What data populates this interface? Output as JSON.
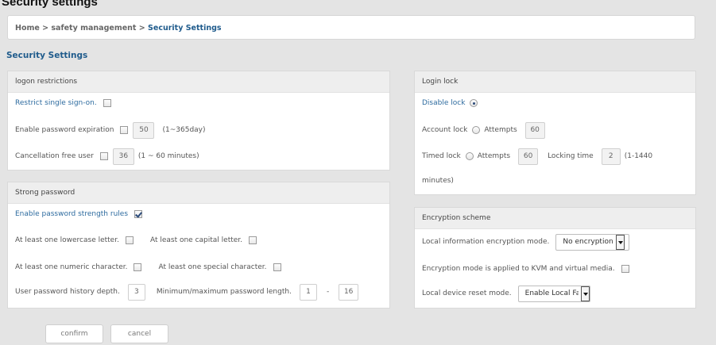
{
  "page": {
    "heading": "Security settings"
  },
  "breadcrumb": {
    "home": "Home",
    "sep1": " > ",
    "parent": "safety management",
    "sep2": " > ",
    "current": "Security Settings"
  },
  "section_title": "Security Settings",
  "logon_restrictions": {
    "header": "logon restrictions",
    "single_signon_label": "Restrict single sign-on.",
    "single_signon_checked": false,
    "pwd_expiration_label": "Enable password expiration",
    "pwd_expiration_checked": false,
    "pwd_expiration_value": "50",
    "pwd_expiration_hint": "(1~365day)",
    "cancellation_label": "Cancellation free user",
    "cancellation_checked": false,
    "cancellation_value": "36",
    "cancellation_hint": "(1 ~ 60 minutes)"
  },
  "strong_password": {
    "header": "Strong password",
    "enable_rules_label": "Enable password strength rules",
    "enable_rules_checked": true,
    "lowercase_label": "At least one lowercase letter.",
    "capital_label": "At least one capital letter.",
    "numeric_label": "At least one numeric character.",
    "special_label": "At least one special character.",
    "history_label": "User password history depth.",
    "history_value": "3",
    "length_label": "Minimum/maximum password length.",
    "length_min": "1",
    "length_sep": "-",
    "length_max": "16"
  },
  "login_lock": {
    "header": "Login lock",
    "disable_label": "Disable lock",
    "account_label": "Account lock",
    "account_attempts_label": "Attempts",
    "account_attempts_value": "60",
    "timed_label": "Timed lock",
    "timed_attempts_label": "Attempts",
    "timed_attempts_value": "60",
    "locking_time_label": "Locking time",
    "locking_time_value": "2",
    "locking_time_hint": "(1-1440",
    "locking_time_hint2": "minutes)",
    "selected": "disable"
  },
  "encryption": {
    "header": "Encryption scheme",
    "local_mode_label": "Local information encryption mode.",
    "local_mode_value": "No encryption",
    "kvm_label": "Encryption mode is applied to KVM and virtual media.",
    "reset_label": "Local device reset mode.",
    "reset_value": "Enable Local Fact"
  },
  "actions": {
    "confirm": "confirm",
    "cancel": "cancel"
  },
  "colors": {
    "accent_blue": "#1f5b8c",
    "link_blue": "#2d6b9f",
    "background": "#e4e4e4"
  }
}
